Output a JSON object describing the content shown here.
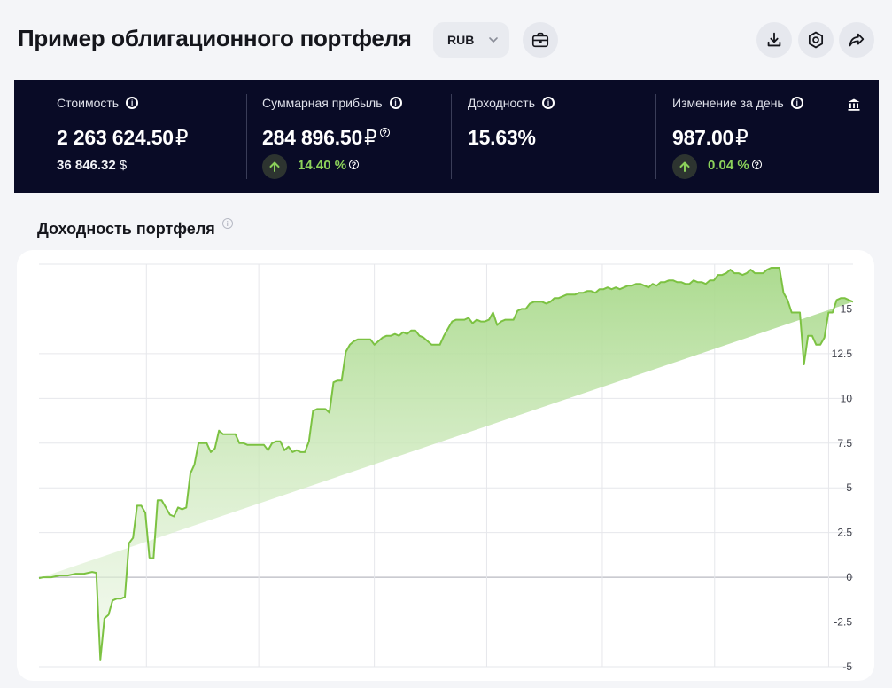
{
  "header": {
    "title": "Пример облигационного портфеля",
    "currency": "RUB",
    "icons": [
      "portfolio-briefcase-icon",
      "download-icon",
      "settings-hexagon-icon",
      "share-icon"
    ]
  },
  "stats": {
    "value": {
      "label": "Стоимость",
      "amount": "2 263 624.50",
      "currency": "₽",
      "alt_amount": "36 846.32",
      "alt_currency": "$"
    },
    "profit": {
      "label": "Суммарная прибыль",
      "amount": "284 896.50",
      "currency": "₽",
      "pct": "14.40 %"
    },
    "yield": {
      "label": "Доходность",
      "amount": "15.63%"
    },
    "day_change": {
      "label": "Изменение за день",
      "amount": "987.00",
      "currency": "₽",
      "pct": "0.04 %"
    }
  },
  "colors": {
    "stats_bg": "#090b26",
    "accent_green": "#7cc242",
    "positive_text": "#8bd15a"
  },
  "chart_section": {
    "title": "Доходность портфеля"
  },
  "chart_data": {
    "type": "area",
    "title": "Доходность портфеля",
    "ylim": [
      -5,
      15
    ],
    "yticks": [
      "15",
      "12.5",
      "10",
      "7.5",
      "5",
      "2.5",
      "0",
      "-2.5",
      "-5"
    ],
    "grid": true,
    "x": [
      0,
      1,
      2,
      3,
      4,
      5,
      6,
      7,
      8,
      9,
      10,
      11,
      12,
      13,
      14,
      15,
      16,
      17,
      18,
      19,
      20,
      21,
      22,
      23,
      24,
      25,
      26,
      27,
      28,
      29,
      30,
      31,
      32,
      33,
      34,
      35,
      36,
      37,
      38,
      39,
      40,
      41,
      42,
      43,
      44,
      45,
      46,
      47,
      48,
      49,
      50,
      51,
      52,
      53,
      54,
      55,
      56,
      57,
      58,
      59,
      60,
      61,
      62,
      63,
      64,
      65,
      66,
      67,
      68,
      69,
      70,
      71,
      72,
      73,
      74,
      75,
      76,
      77,
      78,
      79,
      80,
      81,
      82,
      83,
      84,
      85,
      86,
      87,
      88,
      89,
      90,
      91,
      92,
      93,
      94,
      95,
      96,
      97,
      98,
      99,
      100,
      101,
      102,
      103,
      104,
      105,
      106,
      107,
      108,
      109,
      110,
      111,
      112,
      113,
      114,
      115,
      116,
      117,
      118,
      119,
      120,
      121,
      122,
      123,
      124,
      125,
      126,
      127,
      128,
      129,
      130,
      131,
      132,
      133,
      134,
      135,
      136,
      137,
      138,
      139,
      140,
      141,
      142,
      143,
      144,
      145,
      146,
      147,
      148,
      149,
      150,
      151,
      152,
      153,
      154,
      155,
      156,
      157,
      158,
      159,
      160,
      161,
      162,
      163,
      164,
      165,
      166,
      167,
      168,
      169,
      170,
      171,
      172,
      173,
      174,
      175,
      176,
      177,
      178,
      179,
      180,
      181,
      182,
      183,
      184,
      185,
      186,
      187,
      188,
      189,
      190,
      191,
      192,
      193,
      194,
      195,
      196,
      197,
      198,
      199
    ],
    "values": [
      -0.05,
      0.0,
      0.0,
      0.0,
      0.05,
      0.1,
      0.1,
      0.1,
      0.15,
      0.2,
      0.2,
      0.2,
      0.25,
      0.3,
      0.25,
      -4.6,
      -2.3,
      -2.1,
      -1.3,
      -1.2,
      -1.2,
      -1.1,
      1.9,
      2.2,
      4.0,
      4.0,
      3.6,
      1.1,
      1.05,
      4.3,
      4.3,
      3.9,
      3.5,
      3.4,
      3.9,
      3.8,
      3.9,
      5.8,
      6.3,
      7.5,
      7.5,
      7.5,
      7.0,
      7.2,
      8.2,
      8.0,
      8.0,
      8.0,
      8.0,
      7.5,
      7.5,
      7.4,
      7.4,
      7.4,
      7.4,
      7.4,
      7.1,
      7.5,
      7.6,
      7.6,
      7.1,
      7.3,
      7.0,
      7.1,
      7.0,
      7.0,
      7.6,
      9.3,
      9.4,
      9.4,
      9.4,
      9.2,
      10.9,
      11.0,
      11.0,
      12.6,
      13.0,
      13.2,
      13.3,
      13.3,
      13.3,
      13.3,
      13.0,
      13.2,
      13.4,
      13.5,
      13.5,
      13.6,
      13.5,
      13.7,
      13.6,
      13.8,
      13.8,
      13.5,
      13.4,
      13.2,
      13.0,
      13.0,
      13.0,
      13.5,
      13.9,
      14.3,
      14.4,
      14.4,
      14.4,
      14.5,
      14.2,
      14.4,
      14.3,
      14.3,
      14.4,
      14.8,
      14.1,
      14.3,
      14.4,
      14.4,
      14.4,
      14.9,
      15.0,
      15.0,
      15.3,
      15.4,
      15.4,
      15.4,
      15.3,
      15.4,
      15.6,
      15.6,
      15.7,
      15.8,
      15.8,
      15.8,
      15.9,
      15.9,
      16.0,
      16.0,
      15.9,
      16.1,
      16.1,
      16.2,
      16.1,
      16.2,
      16.1,
      16.2,
      16.3,
      16.3,
      16.4,
      16.4,
      16.3,
      16.2,
      16.4,
      16.3,
      16.5,
      16.5,
      16.6,
      16.6,
      16.5,
      16.5,
      16.4,
      16.4,
      16.6,
      16.5,
      16.5,
      16.4,
      16.6,
      16.6,
      16.9,
      16.9,
      17.0,
      17.2,
      17.0,
      17.0,
      16.9,
      17.0,
      17.2,
      17.0,
      17.0,
      17.0,
      17.2,
      17.3,
      17.3,
      17.3,
      15.9,
      15.5,
      14.8,
      14.8,
      14.8,
      11.9,
      13.5,
      13.5,
      13.0,
      13.0,
      13.4,
      14.8,
      14.8,
      15.5,
      15.6,
      15.6,
      15.5,
      15.4,
      15.4,
      15.4,
      15.5,
      15.6,
      15.6
    ]
  }
}
